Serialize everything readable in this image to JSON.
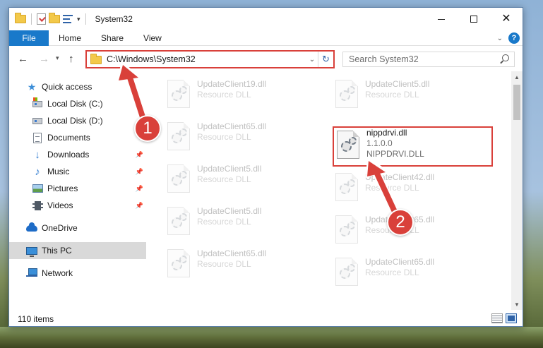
{
  "window": {
    "title": "System32"
  },
  "ribbon": {
    "tabs": [
      "File",
      "Home",
      "Share",
      "View"
    ]
  },
  "nav": {
    "address": "C:\\Windows\\System32",
    "search_placeholder": "Search System32"
  },
  "sidebar": {
    "items": [
      {
        "label": "Quick access",
        "icon": "star-icon",
        "pinned": false
      },
      {
        "label": "Local Disk (C:)",
        "icon": "drive-c-icon",
        "pinned": false
      },
      {
        "label": "Local Disk (D:)",
        "icon": "drive-icon",
        "pinned": false
      },
      {
        "label": "Documents",
        "icon": "documents-icon",
        "pinned": false
      },
      {
        "label": "Downloads",
        "icon": "downloads-icon",
        "pinned": true
      },
      {
        "label": "Music",
        "icon": "music-icon",
        "pinned": true
      },
      {
        "label": "Pictures",
        "icon": "pictures-icon",
        "pinned": true
      },
      {
        "label": "Videos",
        "icon": "videos-icon",
        "pinned": true
      },
      {
        "label": "OneDrive",
        "icon": "onedrive-icon",
        "pinned": false
      },
      {
        "label": "This PC",
        "icon": "this-pc-icon",
        "pinned": false,
        "selected": true
      },
      {
        "label": "Network",
        "icon": "network-icon",
        "pinned": false
      }
    ]
  },
  "files": {
    "left_column": [
      {
        "name": "UpdateClient19.dll",
        "type": "Resource DLL"
      },
      {
        "name": "UpdateClient65.dll",
        "type": "Resource DLL"
      },
      {
        "name": "UpdateClient5.dll",
        "type": "Resource DLL"
      },
      {
        "name": "UpdateClient5.dll",
        "type": "Resource DLL"
      },
      {
        "name": "UpdateClient65.dll",
        "type": "Resource DLL"
      }
    ],
    "right_column": [
      {
        "name": "UpdateClient5.dll",
        "type": "Resource DLL"
      },
      {
        "name": "UpdateClient42.dll",
        "type": "Resource DLL"
      },
      {
        "name": "UpdateClient65.dll",
        "type": "Resource DLL"
      },
      {
        "name": "UpdateClient65.dll",
        "type": "Resource DLL"
      }
    ],
    "highlighted": {
      "name": "nippdrvi.dll",
      "version": "1.1.0.0",
      "description": "NIPPDRVI.DLL"
    }
  },
  "status": {
    "item_count": "110 items"
  },
  "annotations": {
    "step1": "1",
    "step2": "2"
  },
  "colors": {
    "accent": "#1979ca",
    "annotation_red": "#d9403a",
    "selection": "#cce8ff"
  }
}
